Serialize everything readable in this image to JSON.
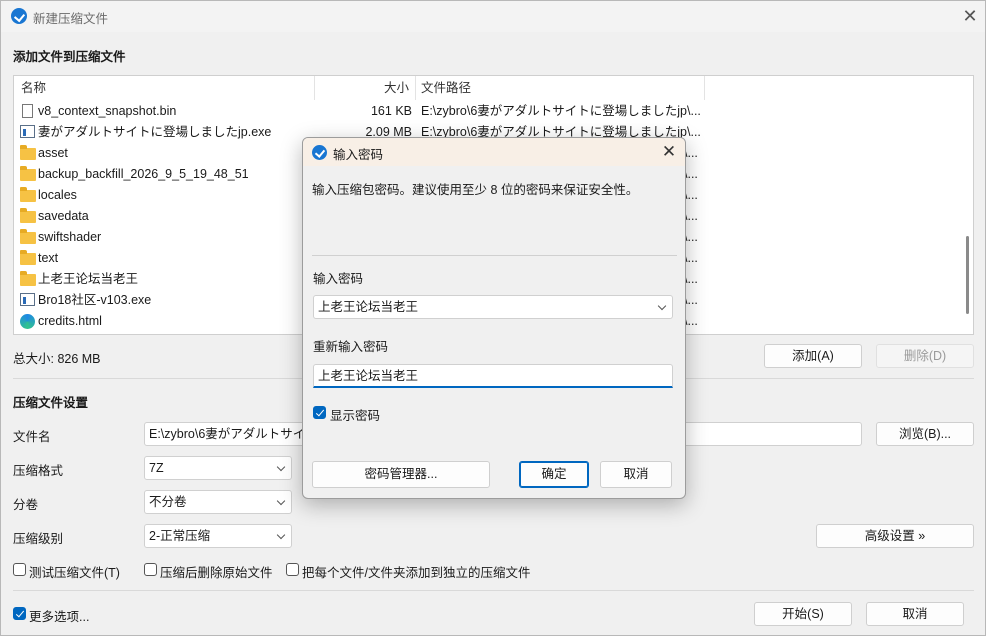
{
  "window": {
    "title": "新建压缩文件",
    "close_label": "✕"
  },
  "add_section": {
    "heading": "添加文件到压缩文件"
  },
  "list": {
    "columns": {
      "name": "名称",
      "size": "大小",
      "path": "文件路径"
    },
    "rows": [
      {
        "icon": "file-icon",
        "name": "v8_context_snapshot.bin",
        "size": "161 KB",
        "path": "E:\\zybro\\6妻がアダルトサイトに登場しましたjp\\..."
      },
      {
        "icon": "exe-icon",
        "name": "妻がアダルトサイトに登場しましたjp.exe",
        "size": "2.09 MB",
        "path": "E:\\zybro\\6妻がアダルトサイトに登場しましたjp\\..."
      },
      {
        "icon": "folder-icon",
        "name": "asset",
        "size": "",
        "path": "\\..."
      },
      {
        "icon": "folder-icon",
        "name": "backup_backfill_2026_9_5_19_48_51",
        "size": "",
        "path": "\\..."
      },
      {
        "icon": "folder-icon",
        "name": "locales",
        "size": "",
        "path": "\\..."
      },
      {
        "icon": "folder-icon",
        "name": "savedata",
        "size": "",
        "path": "\\..."
      },
      {
        "icon": "folder-icon",
        "name": "swiftshader",
        "size": "",
        "path": "\\..."
      },
      {
        "icon": "folder-icon",
        "name": "text",
        "size": "",
        "path": "\\..."
      },
      {
        "icon": "folder-icon",
        "name": "上老王论坛当老王",
        "size": "",
        "path": "\\..."
      },
      {
        "icon": "exe-icon",
        "name": "Bro18社区-v103.exe",
        "size": "",
        "path": "\\..."
      },
      {
        "icon": "edge-icon",
        "name": "credits.html",
        "size": "",
        "path": "\\..."
      }
    ]
  },
  "total_size": "总大小: 826 MB",
  "buttons": {
    "add": "添加(A)",
    "delete": "删除(D)",
    "browse": "浏览(B)...",
    "advanced": "高级设置 »",
    "start": "开始(S)",
    "cancel": "取消"
  },
  "settings": {
    "heading": "压缩文件设置",
    "filename_label": "文件名",
    "filename_value": "E:\\zybro\\6妻がアダルトサイ",
    "format_label": "压缩格式",
    "format_value": "7Z",
    "volume_label": "分卷",
    "volume_value": "不分卷",
    "level_label": "压缩级别",
    "level_value": "2-正常压缩",
    "opt_test": "测试压缩文件(T)",
    "opt_delete": "压缩后删除原始文件",
    "opt_each": "把每个文件/文件夹添加到独立的压缩文件",
    "more_options": "更多选项..."
  },
  "dialog": {
    "title": "输入密码",
    "description": "输入压缩包密码。建议使用至少 8 位的密码来保证安全性。",
    "pwd_label": "输入密码",
    "pwd_value": "上老王论坛当老王",
    "repeat_label": "重新输入密码",
    "repeat_value": "上老王论坛当老王",
    "show_password": "显示密码",
    "manager_button": "密码管理器...",
    "ok_button": "确定",
    "cancel_button": "取消"
  },
  "colors": {
    "accent": "#0067c0",
    "folder": "#f6c244",
    "dialog_title_bg": "#f8efe6"
  }
}
